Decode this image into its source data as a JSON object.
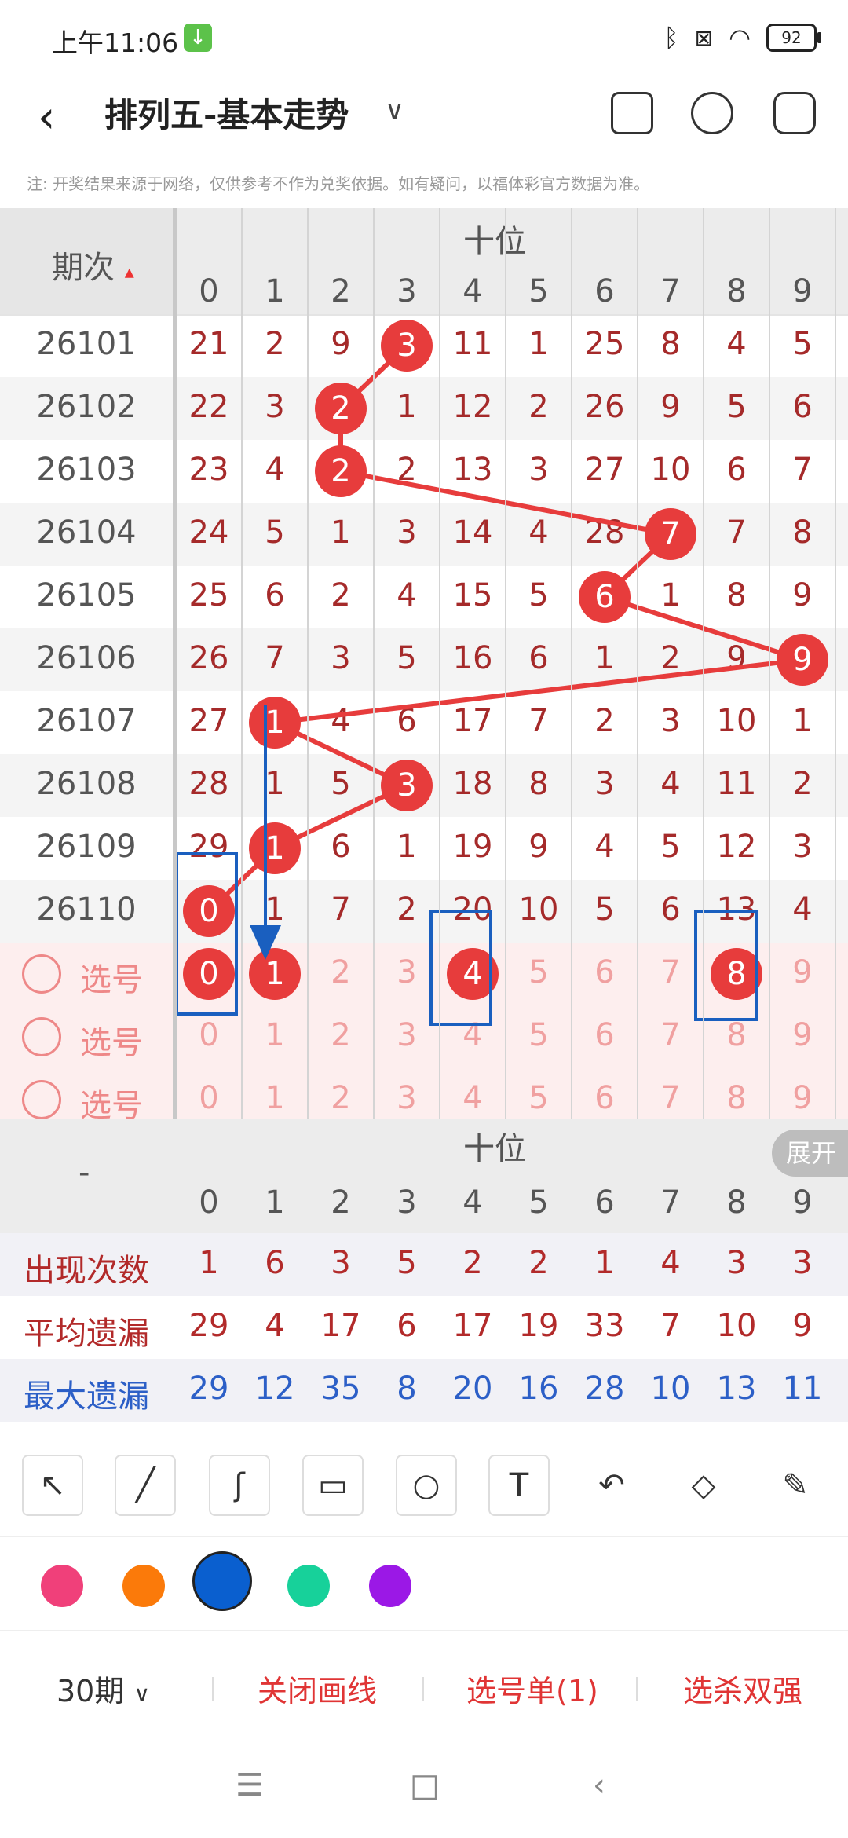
{
  "status": {
    "time": "上午11:06",
    "battery": "92"
  },
  "header": {
    "title": "排列五-基本走势",
    "notice": "注: 开奖结果来源于网络，仅供参考不作为兑奖依据。如有疑问，以福体彩官方数据为准。"
  },
  "table": {
    "period_header": "期次",
    "group_header": "十位",
    "digits": [
      "0",
      "1",
      "2",
      "3",
      "4",
      "5",
      "6",
      "7",
      "8",
      "9"
    ],
    "rows": [
      {
        "period": "26101",
        "cells": [
          "21",
          "2",
          "9",
          "3",
          "11",
          "1",
          "25",
          "8",
          "4",
          "5"
        ],
        "hit": 3
      },
      {
        "period": "26102",
        "cells": [
          "22",
          "3",
          "2",
          "1",
          "12",
          "2",
          "26",
          "9",
          "5",
          "6"
        ],
        "hit": 2
      },
      {
        "period": "26103",
        "cells": [
          "23",
          "4",
          "2",
          "2",
          "13",
          "3",
          "27",
          "10",
          "6",
          "7"
        ],
        "hit": 2
      },
      {
        "period": "26104",
        "cells": [
          "24",
          "5",
          "1",
          "3",
          "14",
          "4",
          "28",
          "7",
          "7",
          "8"
        ],
        "hit": 7
      },
      {
        "period": "26105",
        "cells": [
          "25",
          "6",
          "2",
          "4",
          "15",
          "5",
          "6",
          "1",
          "8",
          "9"
        ],
        "hit": 6
      },
      {
        "period": "26106",
        "cells": [
          "26",
          "7",
          "3",
          "5",
          "16",
          "6",
          "1",
          "2",
          "9",
          "9"
        ],
        "hit": 9
      },
      {
        "period": "26107",
        "cells": [
          "27",
          "1",
          "4",
          "6",
          "17",
          "7",
          "2",
          "3",
          "10",
          "1"
        ],
        "hit": 1
      },
      {
        "period": "26108",
        "cells": [
          "28",
          "1",
          "5",
          "3",
          "18",
          "8",
          "3",
          "4",
          "11",
          "2"
        ],
        "hit": 3
      },
      {
        "period": "26109",
        "cells": [
          "29",
          "1",
          "6",
          "1",
          "19",
          "9",
          "4",
          "5",
          "12",
          "3"
        ],
        "hit": 1
      },
      {
        "period": "26110",
        "cells": [
          "0",
          "1",
          "7",
          "2",
          "20",
          "10",
          "5",
          "6",
          "13",
          "4"
        ],
        "hit": 0
      }
    ],
    "pick_label": "选号",
    "pick_rows": [
      {
        "selected": [
          0,
          1,
          4,
          8
        ]
      },
      {
        "selected": []
      },
      {
        "selected": []
      }
    ]
  },
  "stats": {
    "separator": "-",
    "group_header": "十位",
    "expand": "展开",
    "rows": [
      {
        "label": "出现次数",
        "color": "#b22a2a",
        "values": [
          "1",
          "6",
          "3",
          "5",
          "2",
          "2",
          "1",
          "4",
          "3",
          "3"
        ]
      },
      {
        "label": "平均遗漏",
        "color": "#b22a2a",
        "values": [
          "29",
          "4",
          "17",
          "6",
          "17",
          "19",
          "33",
          "7",
          "10",
          "9"
        ]
      },
      {
        "label": "最大遗漏",
        "color": "#2c5fc7",
        "values": [
          "29",
          "12",
          "35",
          "8",
          "20",
          "16",
          "28",
          "10",
          "13",
          "11"
        ]
      }
    ]
  },
  "tools": [
    "arrow-tool",
    "line-tool",
    "curve-tool",
    "rect-tool",
    "circle-tool",
    "text-tool",
    "undo-tool",
    "eraser-tool",
    "clear-tool"
  ],
  "colors": [
    "#f0407a",
    "#fb7a0a",
    "#0a5fcf",
    "#17d19a",
    "#9b18e6"
  ],
  "bottom_bar": {
    "periods": "30期",
    "close_draw": "关闭画线",
    "pick_list": "选号单(1)",
    "kill": "选杀双强"
  }
}
